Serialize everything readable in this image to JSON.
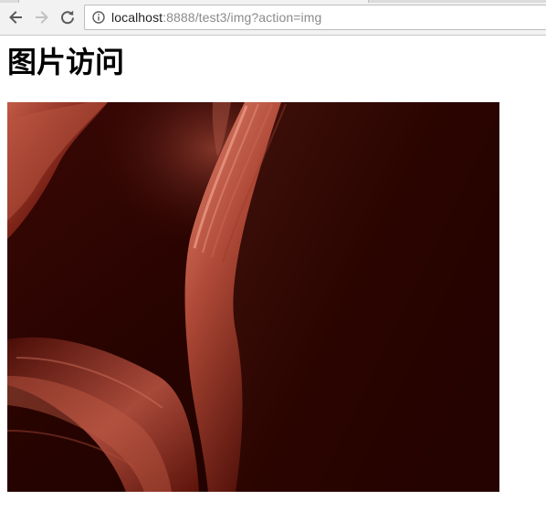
{
  "browser": {
    "back_icon": "arrow-left-icon",
    "forward_icon": "arrow-right-icon",
    "reload_icon": "reload-icon",
    "info_icon": "info-circle-icon",
    "url": {
      "host": "localhost",
      "rest": ":8888/test3/img?action=img"
    }
  },
  "page": {
    "title": "图片访问",
    "image_description_icon": "canyon-photo"
  },
  "colors": {
    "photo_dark": "#1f0200",
    "photo_light": "#d46a55"
  }
}
